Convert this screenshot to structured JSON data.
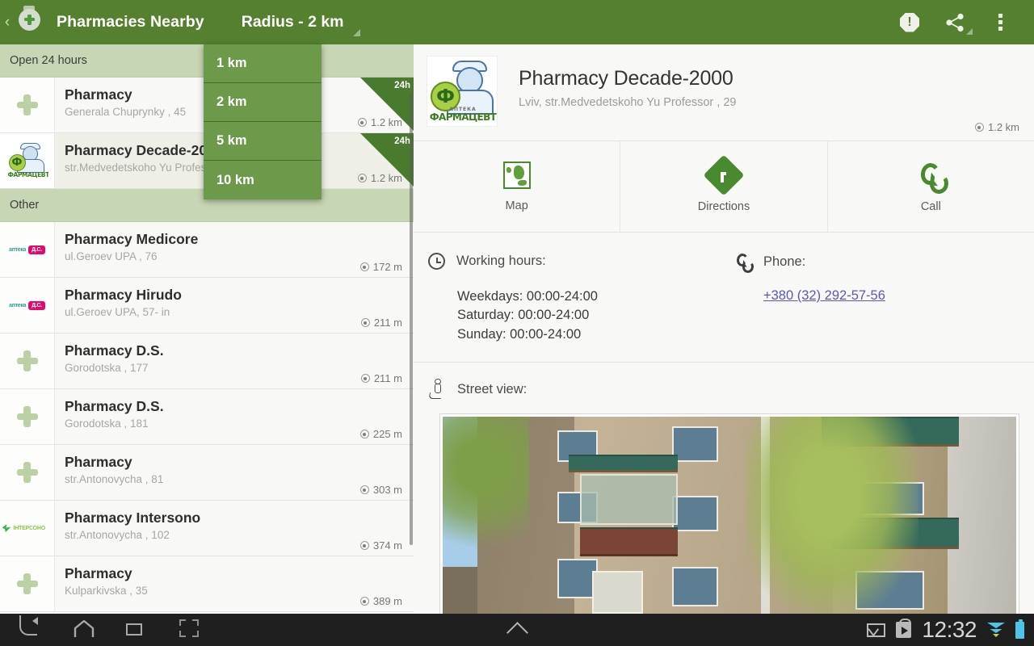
{
  "actionbar": {
    "back_icon": "back-chevron-icon",
    "app_icon": "pharmacy-pin-icon",
    "title": "Pharmacies Nearby",
    "spinner_label": "Radius - 2 km",
    "icons": {
      "alert": "alert-icon",
      "share": "share-icon",
      "overflow": "overflow-menu-icon"
    }
  },
  "radius_dropdown": {
    "options": [
      {
        "label": "1 km"
      },
      {
        "label": "2 km"
      },
      {
        "label": "5 km"
      },
      {
        "label": "10 km"
      }
    ]
  },
  "list": {
    "sections": [
      {
        "header": "Open 24 hours",
        "items": [
          {
            "name": "Pharmacy",
            "address": "Generala Chuprynky , 45",
            "distance": "1.2 km",
            "badge": "24h",
            "icon": "green-cross-icon",
            "selected": false
          },
          {
            "name": "Pharmacy Decade-2000",
            "address": "str.Medvedetskoho Yu Professor , 29",
            "distance": "1.2 km",
            "badge": "24h",
            "icon": "farmacevt-logo-icon",
            "selected": true
          }
        ]
      },
      {
        "header": "Other",
        "items": [
          {
            "name": "Pharmacy Medicore",
            "address": "ul.Geroev UPA , 76",
            "distance": "172 m",
            "badge": "",
            "icon": "apteka-ds-logo-icon",
            "selected": false
          },
          {
            "name": "Pharmacy Hirudo",
            "address": "ul.Geroev UPA, 57- in",
            "distance": "211 m",
            "badge": "",
            "icon": "apteka-ds-logo-icon",
            "selected": false
          },
          {
            "name": "Pharmacy D.S.",
            "address": "Gorodotska , 177",
            "distance": "211 m",
            "badge": "",
            "icon": "green-cross-icon",
            "selected": false
          },
          {
            "name": "Pharmacy D.S.",
            "address": "Gorodotska , 181",
            "distance": "225 m",
            "badge": "",
            "icon": "green-cross-icon",
            "selected": false
          },
          {
            "name": "Pharmacy",
            "address": "str.Antonovycha , 81",
            "distance": "303 m",
            "badge": "",
            "icon": "green-cross-icon",
            "selected": false
          },
          {
            "name": "Pharmacy Intersono",
            "address": "str.Antonovycha , 102",
            "distance": "374 m",
            "badge": "",
            "icon": "intersono-logo-icon",
            "selected": false
          },
          {
            "name": "Pharmacy",
            "address": "Kulparkivska , 35",
            "distance": "389 m",
            "badge": "",
            "icon": "green-cross-icon",
            "selected": false
          }
        ]
      }
    ]
  },
  "detail": {
    "logo_word": "ФАРМАЦЕВТ",
    "logo_sub": "АПТЕКА",
    "name": "Pharmacy Decade-2000",
    "address": "Lviv, str.Medvedetskoho Yu Professor , 29",
    "distance": "1.2 km",
    "actions": [
      {
        "label": "Map",
        "icon": "map-icon"
      },
      {
        "label": "Directions",
        "icon": "directions-icon"
      },
      {
        "label": "Call",
        "icon": "phone-icon"
      }
    ],
    "working_hours_label": "Working hours:",
    "working_hours": [
      "Weekdays: 00:00-24:00",
      "Saturday: 00:00-24:00",
      "Sunday: 00:00-24:00"
    ],
    "phone_label": "Phone:",
    "phone_value": "+380 (32) 292-57-56",
    "street_view_label": "Street view:"
  },
  "navbar": {
    "back": "back-icon",
    "home": "home-icon",
    "recents": "recent-apps-icon",
    "screenshot": "screenshot-icon",
    "expand": "chevron-up-icon",
    "status": {
      "gmail": "gmail-icon",
      "play": "play-store-icon",
      "time": "12:32",
      "wifi": "wifi-icon",
      "battery": "battery-icon"
    }
  },
  "colors": {
    "primary": "#54802f",
    "dropdown": "#6c9a4a",
    "section_header": "#c7d6b4",
    "accent_green": "#4a8a2e",
    "link": "#5b59b5"
  }
}
